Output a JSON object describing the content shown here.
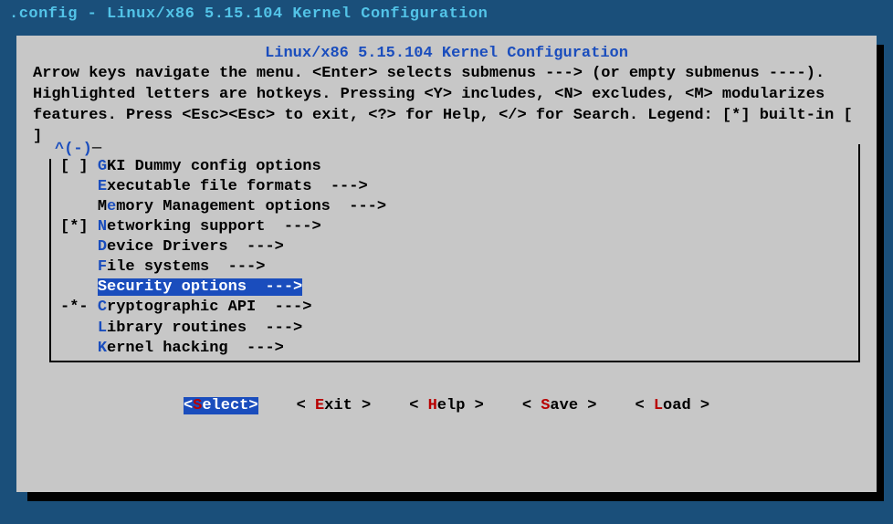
{
  "titleBar": ".config - Linux/x86 5.15.104 Kernel Configuration",
  "dialogTitle": "Linux/x86 5.15.104 Kernel Configuration",
  "helpText": "Arrow keys navigate the menu.  <Enter> selects submenus ---> (or empty submenus ----).  Highlighted letters are hotkeys.  Pressing <Y> includes, <N> excludes, <M> modularizes features.  Press <Esc><Esc> to exit, <?> for Help, </> for Search.  Legend: [*] built-in  [ ]",
  "scrollIndicator": "^(-)",
  "menu": [
    {
      "marker": "[ ]",
      "hotkey": "G",
      "rest": "KI Dummy config options",
      "arrow": "",
      "selected": false
    },
    {
      "marker": "   ",
      "hotkey": "E",
      "rest": "xecutable file formats",
      "arrow": "  --->",
      "selected": false
    },
    {
      "marker": "   ",
      "hotkey": "M",
      "pre": "",
      "rest": "mory Management options",
      "hk2pos": 1,
      "label": "Memory Management options",
      "arrow": "  --->",
      "selected": false
    },
    {
      "marker": "[*]",
      "hotkey": "N",
      "rest": "etworking support",
      "arrow": "  --->",
      "selected": false
    },
    {
      "marker": "   ",
      "hotkey": "D",
      "rest": "evice Drivers",
      "arrow": "  --->",
      "selected": false
    },
    {
      "marker": "   ",
      "hotkey": "F",
      "rest": "ile systems",
      "arrow": "  --->",
      "selected": false
    },
    {
      "marker": "   ",
      "hotkey": "S",
      "rest": "ecurity options",
      "arrow": "  --->",
      "selected": true
    },
    {
      "marker": "-*-",
      "hotkey": "C",
      "rest": "ryptographic API",
      "arrow": "  --->",
      "selected": false
    },
    {
      "marker": "   ",
      "hotkey": "L",
      "rest": "ibrary routines",
      "arrow": "  --->",
      "selected": false
    },
    {
      "marker": "   ",
      "hotkey": "K",
      "rest": "ernel hacking",
      "arrow": "  --->",
      "selected": false
    }
  ],
  "buttons": [
    {
      "pre": "<",
      "hotkey": "S",
      "rest": "elect>",
      "active": true
    },
    {
      "pre": "< ",
      "hotkey": "E",
      "rest": "xit >",
      "active": false
    },
    {
      "pre": "< ",
      "hotkey": "H",
      "rest": "elp >",
      "active": false
    },
    {
      "pre": "< ",
      "hotkey": "S",
      "rest": "ave >",
      "active": false
    },
    {
      "pre": "< ",
      "hotkey": "L",
      "rest": "oad >",
      "active": false
    }
  ]
}
